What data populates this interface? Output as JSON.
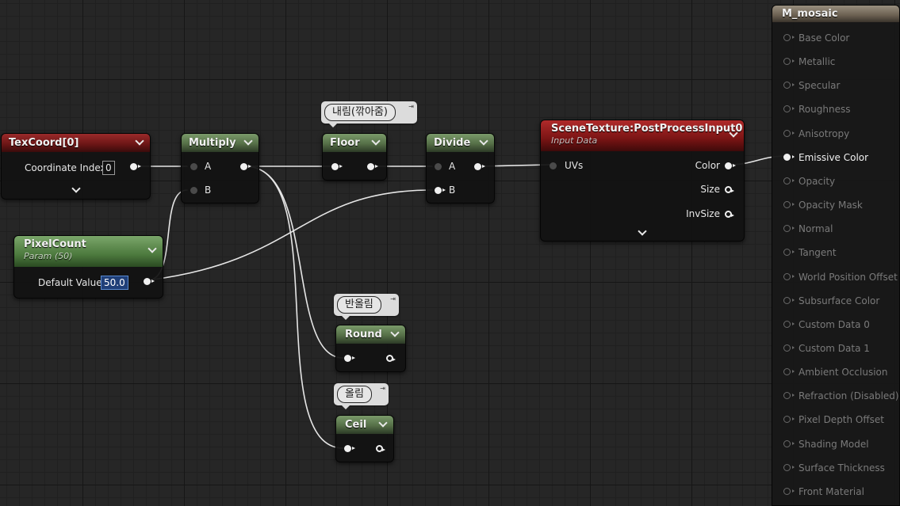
{
  "nodes": {
    "texcoord": {
      "title": "TexCoord[0]",
      "pin_label": "Coordinate Index",
      "value": "0"
    },
    "multiply": {
      "title": "Multiply",
      "pin_a": "A",
      "pin_b": "B"
    },
    "floor": {
      "title": "Floor",
      "comment": "내림(깎아줌)"
    },
    "divide": {
      "title": "Divide",
      "pin_a": "A",
      "pin_b": "B"
    },
    "scene": {
      "title": "SceneTexture:PostProcessInput0",
      "subtitle": "Input Data",
      "in_uvs": "UVs",
      "out_color": "Color",
      "out_size": "Size",
      "out_invsize": "InvSize"
    },
    "pixelcount": {
      "title": "PixelCount",
      "subtitle": "Param (50)",
      "pin_label": "Default Value",
      "value": "50.0"
    },
    "round": {
      "title": "Round",
      "comment": "반올림"
    },
    "ceil": {
      "title": "Ceil",
      "comment": "올림"
    }
  },
  "material": {
    "title": "M_mosaic",
    "inputs": [
      "Base Color",
      "Metallic",
      "Specular",
      "Roughness",
      "Anisotropy",
      "Emissive Color",
      "Opacity",
      "Opacity Mask",
      "Normal",
      "Tangent",
      "World Position Offset",
      "Subsurface Color",
      "Custom Data 0",
      "Custom Data 1",
      "Ambient Occlusion",
      "Refraction (Disabled)",
      "Pixel Depth Offset",
      "Shading Model",
      "Surface Thickness",
      "Front Material"
    ],
    "active_input": "Emissive Color"
  },
  "colors": {
    "background": "#262626",
    "wire": "#e6e6e6",
    "header_red": "#7a1414",
    "header_green": "#556f47",
    "header_param": "#4d7a3e",
    "result_header": "#6a5f50",
    "selection": "#1f3f78"
  }
}
